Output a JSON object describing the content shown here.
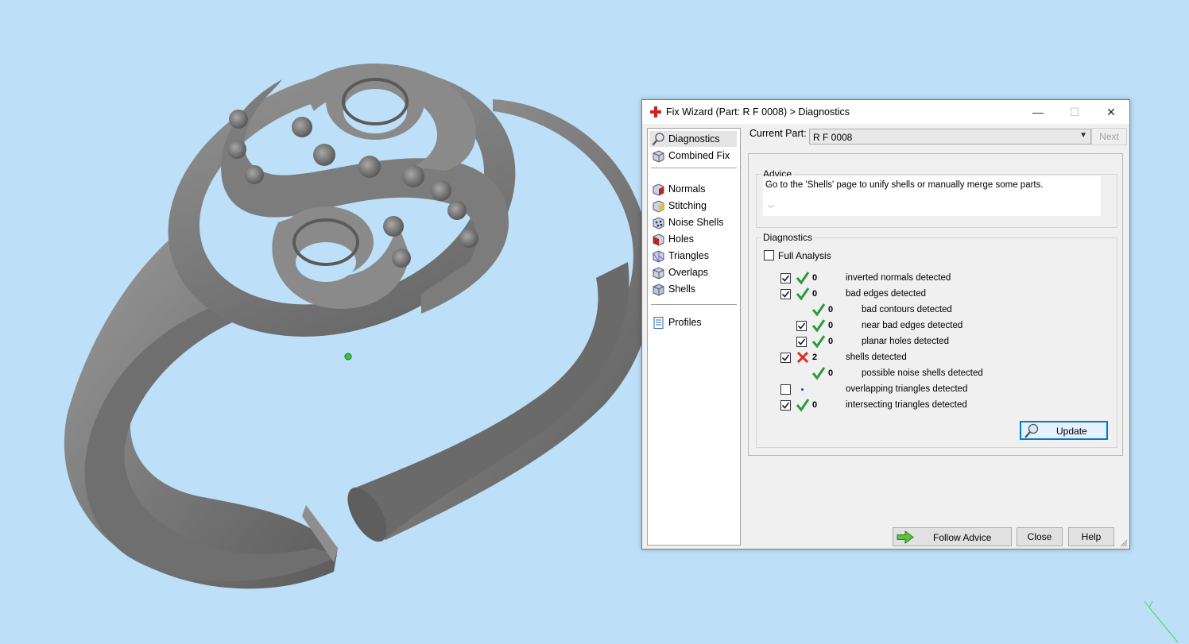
{
  "dialog": {
    "title": "Fix Wizard (Part: R F 0008) > Diagnostics",
    "controls": {
      "minimize": "—",
      "maximize": "☐",
      "close": "✕"
    },
    "nav": {
      "items": [
        {
          "label": "Diagnostics",
          "icon": "magnifier-icon",
          "active": true
        },
        {
          "label": "Combined Fix",
          "icon": "cube-icon"
        },
        {
          "label": "Normals",
          "icon": "cube-red-face-icon"
        },
        {
          "label": "Stitching",
          "icon": "cube-stitch-icon"
        },
        {
          "label": "Noise Shells",
          "icon": "noise-shells-icon"
        },
        {
          "label": "Holes",
          "icon": "cube-hole-icon"
        },
        {
          "label": "Triangles",
          "icon": "cube-triangles-icon"
        },
        {
          "label": "Overlaps",
          "icon": "cube-overlaps-icon"
        },
        {
          "label": "Shells",
          "icon": "cube-shells-icon"
        },
        {
          "label": "Profiles",
          "icon": "document-icon"
        }
      ]
    },
    "current_part_label": "Current Part:",
    "current_part_value": "R F 0008",
    "next_button": "Next",
    "advice": {
      "title": "Advice",
      "text": "Go to the 'Shells' page to unify shells or manually merge some parts."
    },
    "diagnostics": {
      "title": "Diagnostics",
      "full_analysis_label": "Full Analysis",
      "full_analysis_checked": false,
      "rows": [
        {
          "checkbox": true,
          "checked": true,
          "status": "ok",
          "count": "0",
          "label": "inverted normals detected",
          "indent": 0
        },
        {
          "checkbox": true,
          "checked": true,
          "status": "ok",
          "count": "0",
          "label": "bad edges detected",
          "indent": 0
        },
        {
          "checkbox": false,
          "checked": false,
          "status": "ok",
          "count": "0",
          "label": "bad contours detected",
          "indent": 1
        },
        {
          "checkbox": true,
          "checked": true,
          "status": "ok",
          "count": "0",
          "label": "near bad edges detected",
          "indent": 1
        },
        {
          "checkbox": true,
          "checked": true,
          "status": "ok",
          "count": "0",
          "label": "planar holes detected",
          "indent": 1
        },
        {
          "checkbox": true,
          "checked": true,
          "status": "error",
          "count": "2",
          "label": "shells detected",
          "indent": 0
        },
        {
          "checkbox": false,
          "checked": false,
          "status": "ok",
          "count": "0",
          "label": "possible noise shells detected",
          "indent": 1
        },
        {
          "checkbox": true,
          "checked": false,
          "status": "none",
          "count": "",
          "label": "overlapping triangles detected",
          "indent": 0
        },
        {
          "checkbox": true,
          "checked": true,
          "status": "ok",
          "count": "0",
          "label": "intersecting triangles detected",
          "indent": 0
        }
      ],
      "update_button": "Update"
    },
    "footer": {
      "follow_advice": "Follow Advice",
      "close": "Close",
      "help": "Help"
    }
  },
  "colors": {
    "viewport_background": "#bddff8",
    "model_gray": "#7d7d7d",
    "ok_check": "#2e9a3a",
    "error_x": "#d93025",
    "focus_border": "#0078d7"
  }
}
